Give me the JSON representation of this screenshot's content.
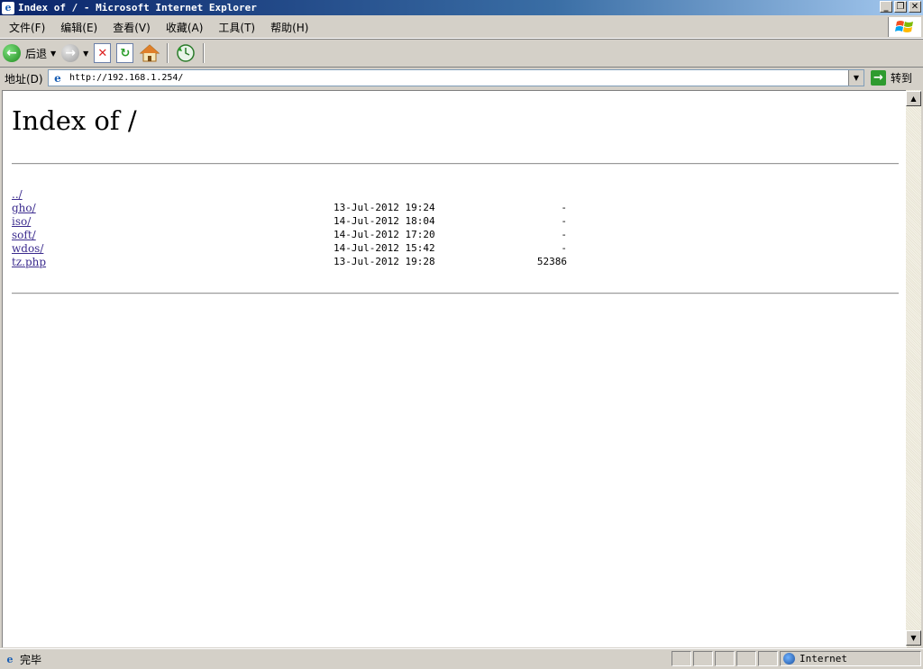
{
  "window": {
    "title": "Index of / - Microsoft Internet Explorer",
    "controls": [
      "_",
      "❐",
      "✕"
    ]
  },
  "menu": {
    "items": [
      "文件(F)",
      "编辑(E)",
      "查看(V)",
      "收藏(A)",
      "工具(T)",
      "帮助(H)"
    ]
  },
  "toolbar": {
    "back_label": "后退"
  },
  "address": {
    "label": "地址(D)",
    "url": "http://192.168.1.254/",
    "go_label": "转到"
  },
  "page": {
    "heading": "Index of /",
    "entries": [
      {
        "name": "../",
        "date": "",
        "size": ""
      },
      {
        "name": "gho/",
        "date": "13-Jul-2012 19:24",
        "size": "-"
      },
      {
        "name": "iso/",
        "date": "14-Jul-2012 18:04",
        "size": "-"
      },
      {
        "name": "soft/",
        "date": "14-Jul-2012 17:20",
        "size": "-"
      },
      {
        "name": "wdos/",
        "date": "14-Jul-2012 15:42",
        "size": "-"
      },
      {
        "name": "tz.php",
        "date": "13-Jul-2012 19:28",
        "size": "52386"
      }
    ]
  },
  "status": {
    "text": "完毕",
    "zone": "Internet"
  },
  "icons": {
    "title": "ie-icon",
    "back": "back-arrow-icon",
    "forward": "forward-arrow-icon",
    "stop": "stop-icon",
    "refresh": "refresh-icon",
    "home": "home-icon",
    "history": "history-icon",
    "go": "go-arrow-icon",
    "zone": "globe-icon"
  },
  "colors": {
    "title_bar": "#0a246a",
    "link": "#3b2b8e",
    "chrome": "#d4d0c8"
  }
}
